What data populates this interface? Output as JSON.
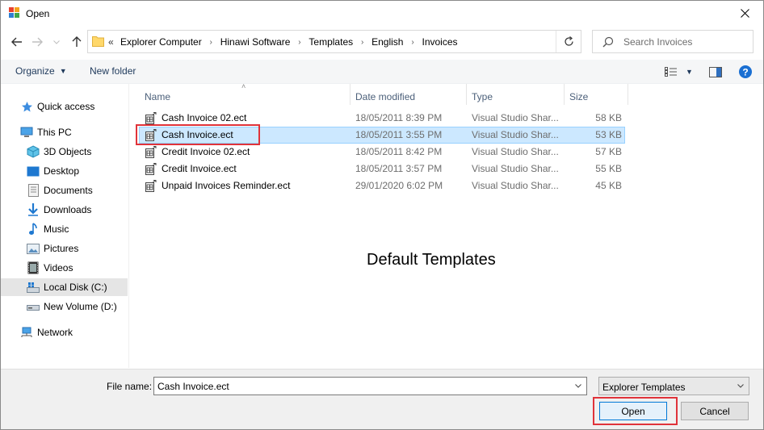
{
  "window": {
    "title": "Open"
  },
  "address": {
    "prefix": "«",
    "crumbs": [
      "Explorer Computer",
      "Hinawi Software",
      "Templates",
      "English",
      "Invoices"
    ]
  },
  "search": {
    "placeholder": "Search Invoices"
  },
  "toolbar": {
    "organize": "Organize",
    "new_folder": "New folder"
  },
  "nav": {
    "quick_access": "Quick access",
    "this_pc": "This PC",
    "objects3d": "3D Objects",
    "desktop": "Desktop",
    "documents": "Documents",
    "downloads": "Downloads",
    "music": "Music",
    "pictures": "Pictures",
    "videos": "Videos",
    "local_disk": "Local Disk (C:)",
    "new_volume": "New Volume (D:)",
    "network": "Network"
  },
  "columns": {
    "name": "Name",
    "date": "Date modified",
    "type": "Type",
    "size": "Size"
  },
  "files": [
    {
      "name": "Cash Invoice 02.ect",
      "date": "18/05/2011 8:39 PM",
      "type": "Visual Studio Shar...",
      "size": "58 KB"
    },
    {
      "name": "Cash Invoice.ect",
      "date": "18/05/2011 3:55 PM",
      "type": "Visual Studio Shar...",
      "size": "53 KB"
    },
    {
      "name": "Credit Invoice 02.ect",
      "date": "18/05/2011 8:42 PM",
      "type": "Visual Studio Shar...",
      "size": "57 KB"
    },
    {
      "name": "Credit Invoice.ect",
      "date": "18/05/2011 3:57 PM",
      "type": "Visual Studio Shar...",
      "size": "55 KB"
    },
    {
      "name": "Unpaid Invoices Reminder.ect",
      "date": "29/01/2020 6:02 PM",
      "type": "Visual Studio Shar...",
      "size": "45 KB"
    }
  ],
  "annotation": {
    "center_label": "Default Templates"
  },
  "bottom": {
    "file_name_label": "File name:",
    "file_name_value": "Cash Invoice.ect",
    "filter": "Explorer Templates",
    "open": "Open",
    "cancel": "Cancel"
  },
  "colors": {
    "accent": "#0078d7",
    "selection": "#cce8ff",
    "highlight": "#e0333a"
  }
}
